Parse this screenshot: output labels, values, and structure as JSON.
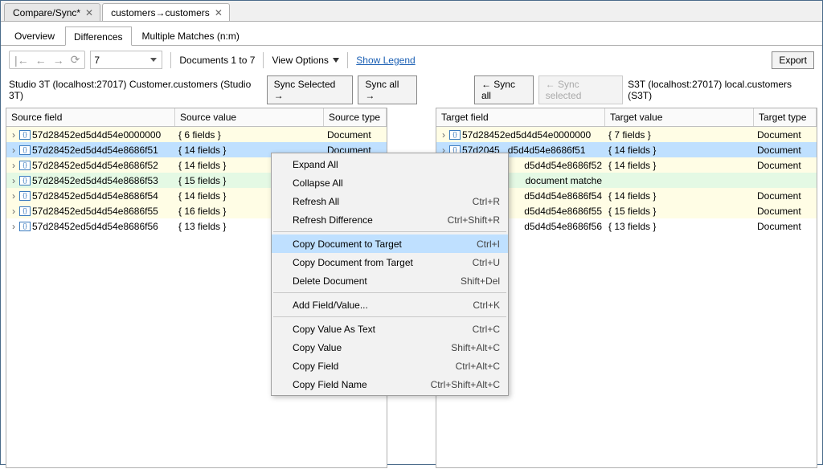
{
  "top_tabs": {
    "compare": "Compare/Sync*",
    "customers": "customers→customers"
  },
  "sub_tabs": {
    "overview": "Overview",
    "differences": "Differences",
    "multiple": "Multiple Matches (n:m)"
  },
  "toolbar": {
    "page_value": "7",
    "doc_range": "Documents 1 to 7",
    "view_options": "View Options",
    "legend": "Show Legend",
    "export": "Export"
  },
  "mid": {
    "source_conn": "Studio 3T (localhost:27017) Customer.customers (Studio 3T)",
    "sync_selected_r": "Sync Selected →",
    "sync_all_r": "Sync all →",
    "sync_all_l": "← Sync all",
    "sync_selected_l": "← Sync selected",
    "target_conn": "S3T (localhost:27017) local.customers (S3T)"
  },
  "cols": {
    "sfield": "Source field",
    "svalue": "Source value",
    "stype": "Source type",
    "tfield": "Target field",
    "tvalue": "Target value",
    "ttype": "Target type"
  },
  "src_rows": [
    {
      "bg": "bg-yellow",
      "id": "57d28452ed5d4d54e0000000",
      "val": "{ 6 fields }",
      "type": "Document"
    },
    {
      "bg": "bg-blue",
      "id": "57d28452ed5d4d54e8686f51",
      "val": "{ 14 fields }",
      "type": "Document"
    },
    {
      "bg": "bg-yellow",
      "id": "57d28452ed5d4d54e8686f52",
      "val": "{ 14 fields }",
      "type": ""
    },
    {
      "bg": "bg-green",
      "id": "57d28452ed5d4d54e8686f53",
      "val": "{ 15 fields }",
      "type": ""
    },
    {
      "bg": "bg-yellow",
      "id": "57d28452ed5d4d54e8686f54",
      "val": "{ 14 fields }",
      "type": ""
    },
    {
      "bg": "bg-yellow",
      "id": "57d28452ed5d4d54e8686f55",
      "val": "{ 16 fields }",
      "type": ""
    },
    {
      "bg": "bg-white",
      "id": "57d28452ed5d4d54e8686f56",
      "val": "{ 13 fields }",
      "type": ""
    }
  ],
  "tgt_rows": [
    {
      "bg": "bg-yellow",
      "id": "57d28452ed5d4d54e0000000",
      "val": "{ 7 fields }",
      "type": "Document"
    },
    {
      "bg": "bg-blue",
      "partial": true,
      "id_prefix": "57d2045",
      "id_suffix": "d5d4d54e8686f51",
      "val": "{ 14 fields }",
      "type": "Document"
    },
    {
      "bg": "bg-yellow",
      "partial": true,
      "id_suffix": "d5d4d54e8686f52",
      "val": "{ 14 fields }",
      "type": "Document"
    },
    {
      "bg": "bg-green",
      "partial": true,
      "id_suffix": "document matche",
      "val": "",
      "type": ""
    },
    {
      "bg": "bg-yellow",
      "partial": true,
      "id_suffix": "d5d4d54e8686f54",
      "val": "{ 14 fields }",
      "type": "Document"
    },
    {
      "bg": "bg-yellow",
      "partial": true,
      "id_suffix": "d5d4d54e8686f55",
      "val": "{ 15 fields }",
      "type": "Document"
    },
    {
      "bg": "bg-white",
      "partial": true,
      "id_suffix": "d5d4d54e8686f56",
      "val": "{ 13 fields }",
      "type": "Document"
    }
  ],
  "cm": {
    "expand": "Expand All",
    "collapse": "Collapse All",
    "refresh_all": "Refresh All",
    "refresh_all_sc": "Ctrl+R",
    "refresh_diff": "Refresh Difference",
    "refresh_diff_sc": "Ctrl+Shift+R",
    "copy_to": "Copy Document to Target",
    "copy_to_sc": "Ctrl+I",
    "copy_from": "Copy Document from Target",
    "copy_from_sc": "Ctrl+U",
    "delete": "Delete Document",
    "delete_sc": "Shift+Del",
    "add_field": "Add Field/Value...",
    "add_field_sc": "Ctrl+K",
    "copy_txt": "Copy Value As Text",
    "copy_txt_sc": "Ctrl+C",
    "copy_val": "Copy Value",
    "copy_val_sc": "Shift+Alt+C",
    "copy_field": "Copy Field",
    "copy_field_sc": "Ctrl+Alt+C",
    "copy_fname": "Copy Field Name",
    "copy_fname_sc": "Ctrl+Shift+Alt+C"
  }
}
